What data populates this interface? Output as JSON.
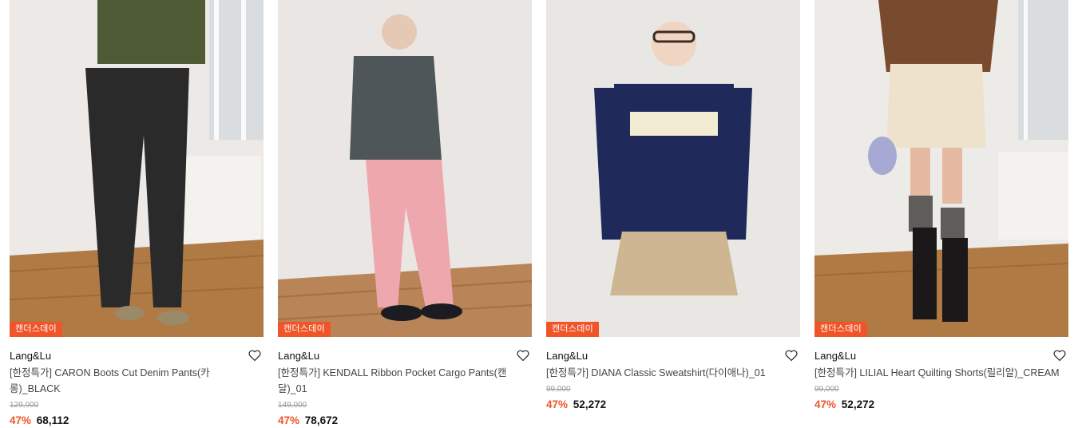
{
  "products": [
    {
      "badge": "캔더스데이",
      "brand": "Lang&Lu",
      "title": "[한정특가] CARON Boots Cut Denim Pants(카롱)_BLACK",
      "original_price": "129,000",
      "discount": "47%",
      "price": "68,112",
      "wishlist_icon": "heart-outline-icon"
    },
    {
      "badge": "캔더스데이",
      "brand": "Lang&Lu",
      "title": "[한정특가] KENDALL Ribbon Pocket Cargo Pants(캔달)_01",
      "original_price": "149,000",
      "discount": "47%",
      "price": "78,672",
      "wishlist_icon": "heart-outline-icon"
    },
    {
      "badge": "캔더스데이",
      "brand": "Lang&Lu",
      "title": "[한정특가] DIANA Classic Sweatshirt(다이애나)_01",
      "original_price": "99,000",
      "discount": "47%",
      "price": "52,272",
      "wishlist_icon": "heart-outline-icon"
    },
    {
      "badge": "캔더스데이",
      "brand": "Lang&Lu",
      "title": "[한정특가] LILIAL Heart Quilting Shorts(릴리알)_CREAM",
      "original_price": "99,000",
      "discount": "47%",
      "price": "52,272",
      "wishlist_icon": "heart-outline-icon"
    }
  ],
  "colors": {
    "accent": "#f0552a",
    "text": "#111111",
    "muted": "#9a9a9a"
  }
}
